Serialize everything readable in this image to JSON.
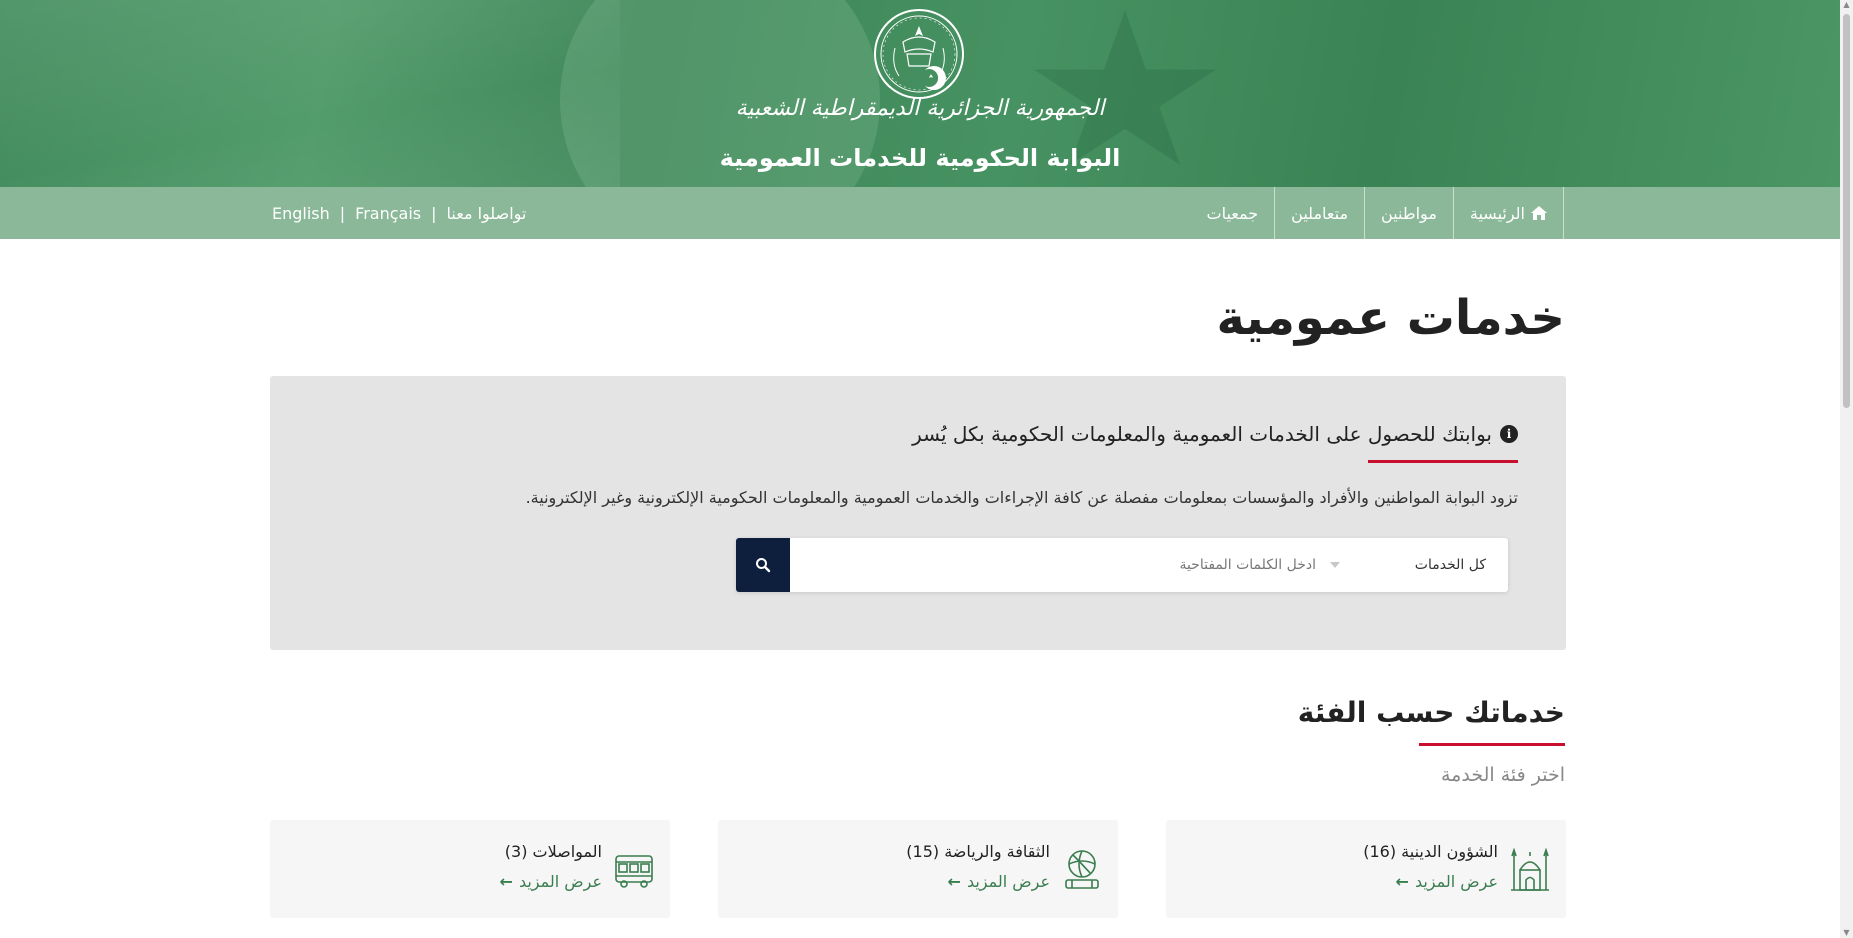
{
  "header": {
    "republic_name": "الجمهورية الجزائرية الديمقراطية الشعبية",
    "portal_name": "البوابة الحكومية للخدمات العمومية",
    "seal_icon": "algeria-seal-icon"
  },
  "nav": {
    "items": [
      {
        "label": "الرئيسية",
        "icon": "home-icon"
      },
      {
        "label": "مواطنين"
      },
      {
        "label": "متعاملين"
      },
      {
        "label": "جمعيات"
      }
    ],
    "contact": "تواصلوا معنا",
    "languages": [
      "Français",
      "English"
    ],
    "separator": "|"
  },
  "main": {
    "page_title": "خدمات عمومية",
    "info": {
      "heading": "بوابتك للحصول على الخدمات العمومية والمعلومات الحكومية بكل يُسر",
      "description": "تزود البوابة المواطنين والأفراد والمؤسسات بمعلومات مفصلة عن كافة الإجراءات والخدمات العمومية والمعلومات الحكومية الإلكترونية وغير الإلكترونية."
    },
    "search": {
      "category_selected": "كل الخدمات",
      "placeholder": "ادخل الكلمات المفتاحية",
      "button_icon": "search-icon"
    },
    "categories_section": {
      "title": "خدماتك حسب الفئة",
      "subtitle": "اختر فئة الخدمة",
      "cards": [
        {
          "title": "الشؤون الدينية (16)",
          "more": "عرض المزيد",
          "icon": "mosque-icon"
        },
        {
          "title": "الثقافة والرياضة (15)",
          "more": "عرض المزيد",
          "icon": "sports-ball-icon"
        },
        {
          "title": "المواصلات (3)",
          "more": "عرض المزيد",
          "icon": "bus-icon"
        }
      ]
    }
  },
  "colors": {
    "banner_green": "#3f8a5a",
    "nav_green": "#8ab898",
    "accent_red": "#c8102e",
    "search_button": "#0d1f3c",
    "link_green": "#3a7d4f"
  }
}
